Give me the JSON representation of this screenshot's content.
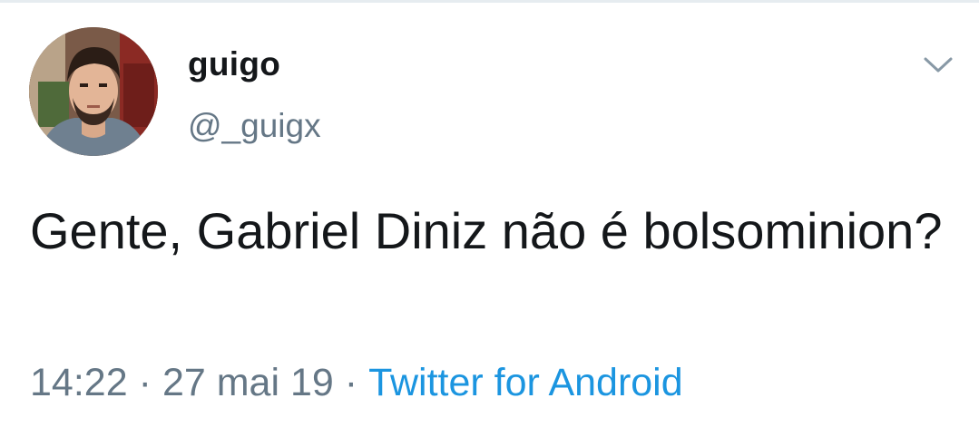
{
  "tweet": {
    "display_name": "guigo",
    "handle": "@_guigx",
    "text": "Gente, Gabriel Diniz não é bolsominion?",
    "time": "14:22",
    "date": "27 mai 19",
    "separator": "·",
    "source": "Twitter for Android"
  },
  "colors": {
    "text": "#14171a",
    "secondary": "#657786",
    "link": "#1b95e0"
  },
  "icons": {
    "menu": "chevron-down-icon",
    "avatar": "profile-photo"
  }
}
